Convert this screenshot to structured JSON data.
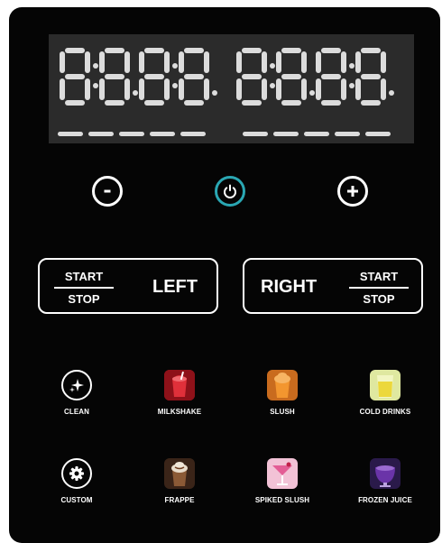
{
  "display": {
    "digits": "88888888",
    "separators": ":.:.:.:."
  },
  "controls": {
    "minus_label": "minus",
    "power_label": "power",
    "plus_label": "plus",
    "accent": "#2aa7b3"
  },
  "left": {
    "start": "START",
    "stop": "STOP",
    "side": "LEFT"
  },
  "right": {
    "start": "START",
    "stop": "STOP",
    "side": "RIGHT"
  },
  "modes": [
    {
      "label": "CLEAN",
      "icon": "sparkle-icon"
    },
    {
      "label": "MILKSHAKE",
      "icon": "milkshake-icon",
      "color": "#d8252e"
    },
    {
      "label": "SLUSH",
      "icon": "slush-icon",
      "color": "#f08a2a"
    },
    {
      "label": "COLD DRINKS",
      "icon": "cold-drink-icon",
      "color": "#e8ef7a"
    },
    {
      "label": "CUSTOM",
      "icon": "gear-icon"
    },
    {
      "label": "FRAPPE",
      "icon": "frappe-icon",
      "color": "#7a4a2a"
    },
    {
      "label": "SPIKED SLUSH",
      "icon": "cocktail-icon",
      "color": "#e98ab5"
    },
    {
      "label": "FROZEN JUICE",
      "icon": "frozen-juice-icon",
      "color": "#5a2c8e"
    }
  ]
}
